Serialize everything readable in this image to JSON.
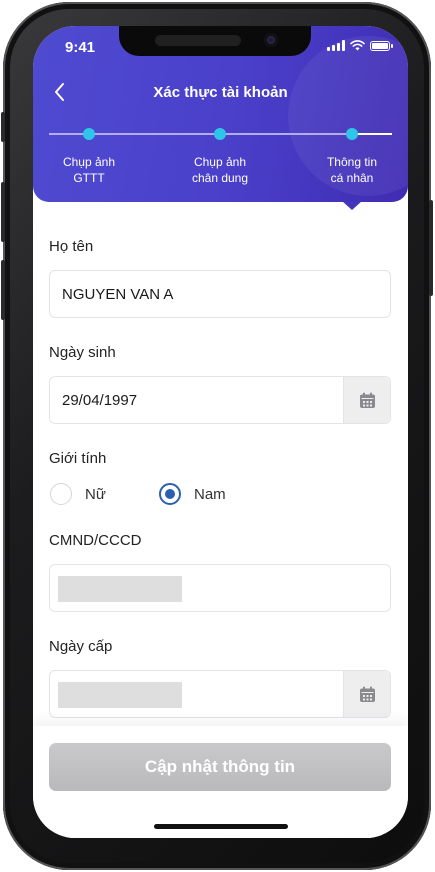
{
  "status_bar": {
    "time": "9:41"
  },
  "header": {
    "title": "Xác thực tài khoản",
    "steps": [
      {
        "label": "Chụp ảnh\nGTTT"
      },
      {
        "label": "Chụp ảnh\nchân dung"
      },
      {
        "label": "Thông tin\ncá nhân"
      }
    ],
    "current_step": 3
  },
  "form": {
    "name": {
      "label": "Họ tên",
      "value": "NGUYEN VAN A"
    },
    "dob": {
      "label": "Ngày sinh",
      "value": "29/04/1997",
      "icon": "calendar-icon"
    },
    "gender": {
      "label": "Giới tính",
      "options": [
        {
          "label": "Nữ",
          "selected": false
        },
        {
          "label": "Nam",
          "selected": true
        }
      ]
    },
    "id_number": {
      "label": "CMND/CCCD",
      "value": ""
    },
    "issue_date": {
      "label": "Ngày cấp",
      "value": "",
      "icon": "calendar-icon"
    }
  },
  "footer": {
    "submit_label": "Cập nhật thông tin"
  },
  "colors": {
    "header_gradient_start": "#4f4bd1",
    "header_gradient_end": "#3f2cb3",
    "step_dot": "#2ec6e8",
    "radio_selected": "#2c5fb0",
    "button_disabled": "#c0c0c2"
  }
}
